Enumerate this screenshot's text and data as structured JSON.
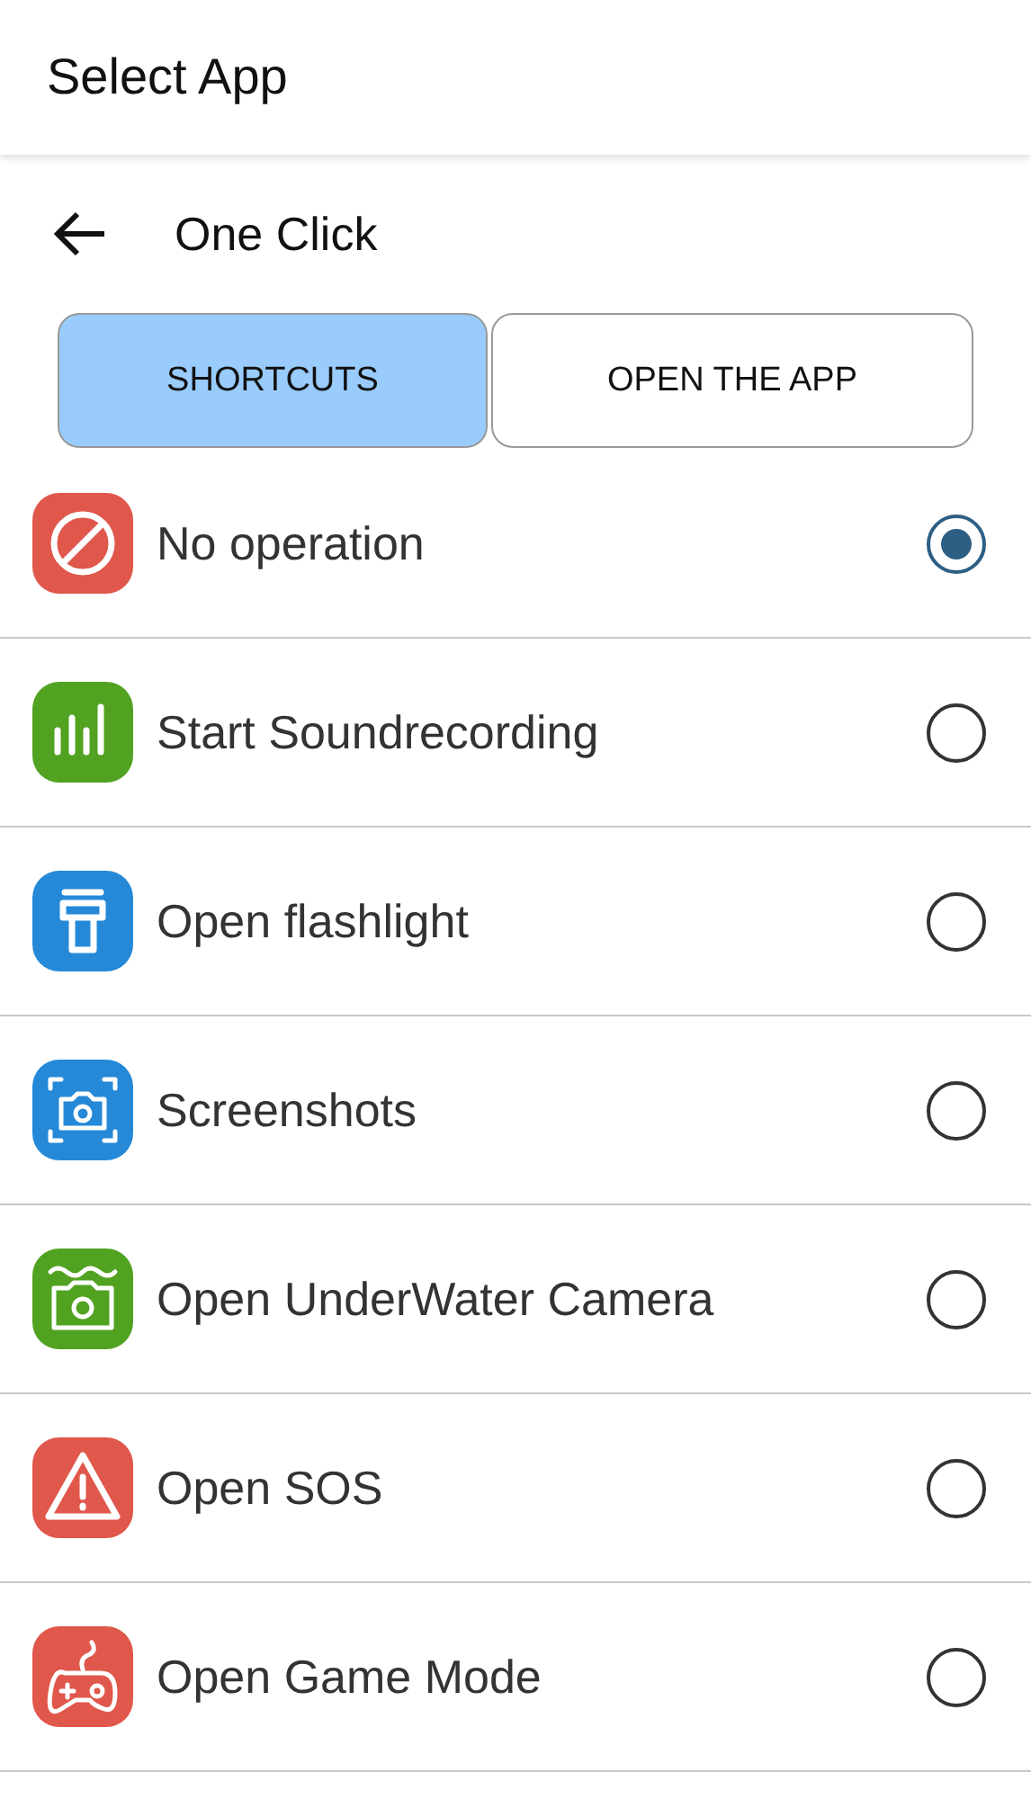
{
  "header": {
    "title": "Select App"
  },
  "nav": {
    "title": "One Click"
  },
  "tabs": [
    {
      "label": "SHORTCUTS",
      "selected": true
    },
    {
      "label": "OPEN THE APP",
      "selected": false
    }
  ],
  "options": [
    {
      "kind": "none",
      "label": "No operation",
      "color": "#e0574b",
      "selected": true
    },
    {
      "kind": "sound",
      "label": "Start Soundrecording",
      "color": "#52a222",
      "selected": false
    },
    {
      "kind": "flashlight",
      "label": "Open flashlight",
      "color": "#2589d8",
      "selected": false
    },
    {
      "kind": "screenshot",
      "label": "Screenshots",
      "color": "#2589d8",
      "selected": false
    },
    {
      "kind": "underwater",
      "label": "Open UnderWater Camera",
      "color": "#52a222",
      "selected": false
    },
    {
      "kind": "sos",
      "label": "Open SOS",
      "color": "#e0574b",
      "selected": false
    },
    {
      "kind": "game",
      "label": "Open Game Mode",
      "color": "#e0574b",
      "selected": false
    }
  ]
}
